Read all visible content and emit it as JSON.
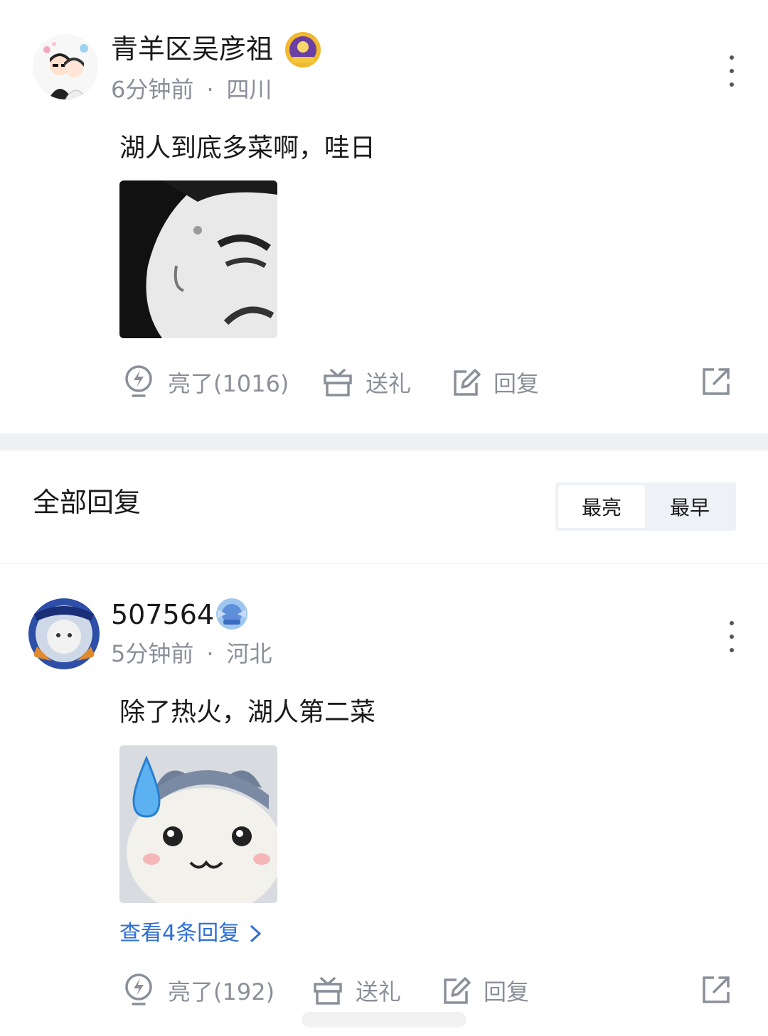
{
  "post": {
    "username": "青羊区吴彦祖",
    "time": "6分钟前",
    "location": "四川",
    "text": "湖人到底多菜啊，哇日",
    "actions": {
      "like_label": "亮了(1016)",
      "gift_label": "送礼",
      "reply_label": "回复"
    },
    "icons": [
      "avatar-couple",
      "badge-gold",
      "more-icon",
      "lightbulb-icon",
      "gift-icon",
      "edit-icon",
      "share-icon"
    ]
  },
  "section": {
    "title": "全部回复",
    "sort_options": [
      "最亮",
      "最早"
    ],
    "selected_sort": "最亮"
  },
  "reply": {
    "username": "507564",
    "time": "5分钟前",
    "location": "河北",
    "text": "除了热火，湖人第二菜",
    "view_replies": "查看4条回复",
    "actions": {
      "like_label": "亮了(192)",
      "gift_label": "送礼",
      "reply_label": "回复"
    }
  },
  "colors": {
    "meta_gray": "#8a8f99",
    "link_blue": "#2f6fd6",
    "band_gray": "#eef0f4"
  }
}
